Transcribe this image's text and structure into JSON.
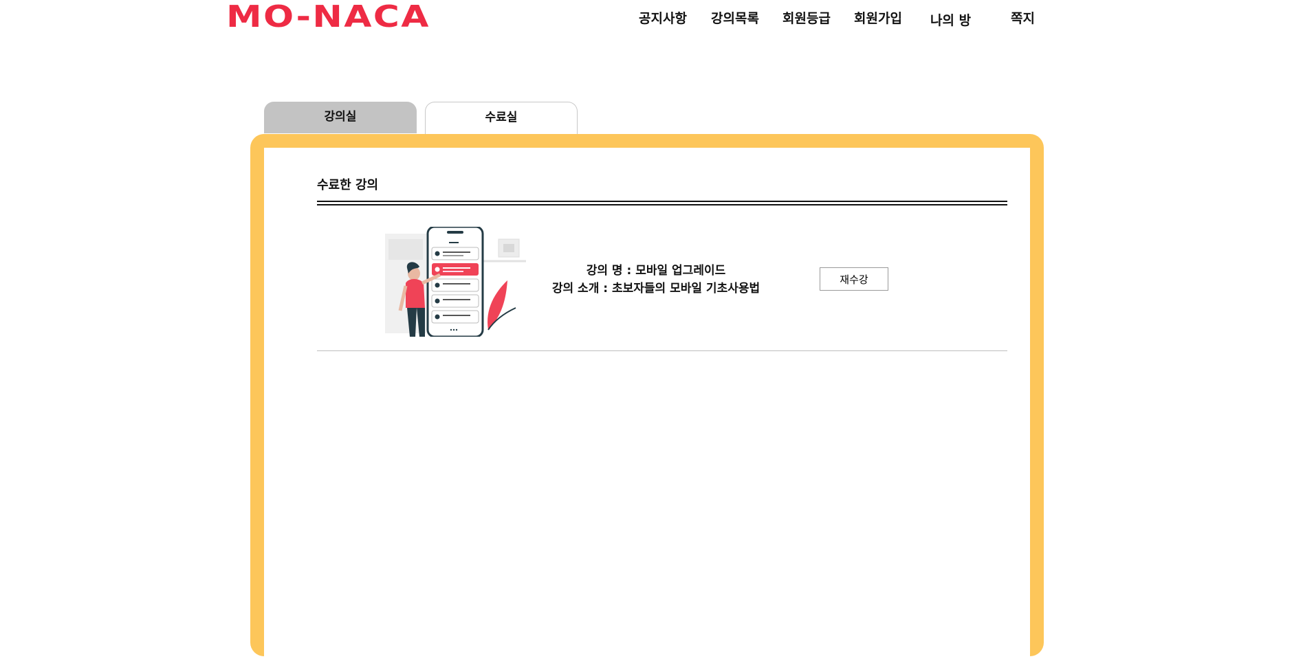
{
  "header": {
    "logo": "MO-NACA",
    "nav": [
      "공지사항",
      "강의목록",
      "회원등급",
      "회원가입",
      "나의 방",
      "쪽지"
    ]
  },
  "tabs": [
    "강의실",
    "수료실"
  ],
  "section": {
    "title": "수료한 강의"
  },
  "course": {
    "name_line": "강의 명 : 모바일 업그레이드",
    "intro_line": "강의 소개 : 초보자들의 모바일 기초사용법",
    "retake_button": "재수강"
  },
  "colors": {
    "brand": "#ee2b44",
    "frame": "#fdc65a",
    "tab_inactive": "#c3c3c3"
  }
}
